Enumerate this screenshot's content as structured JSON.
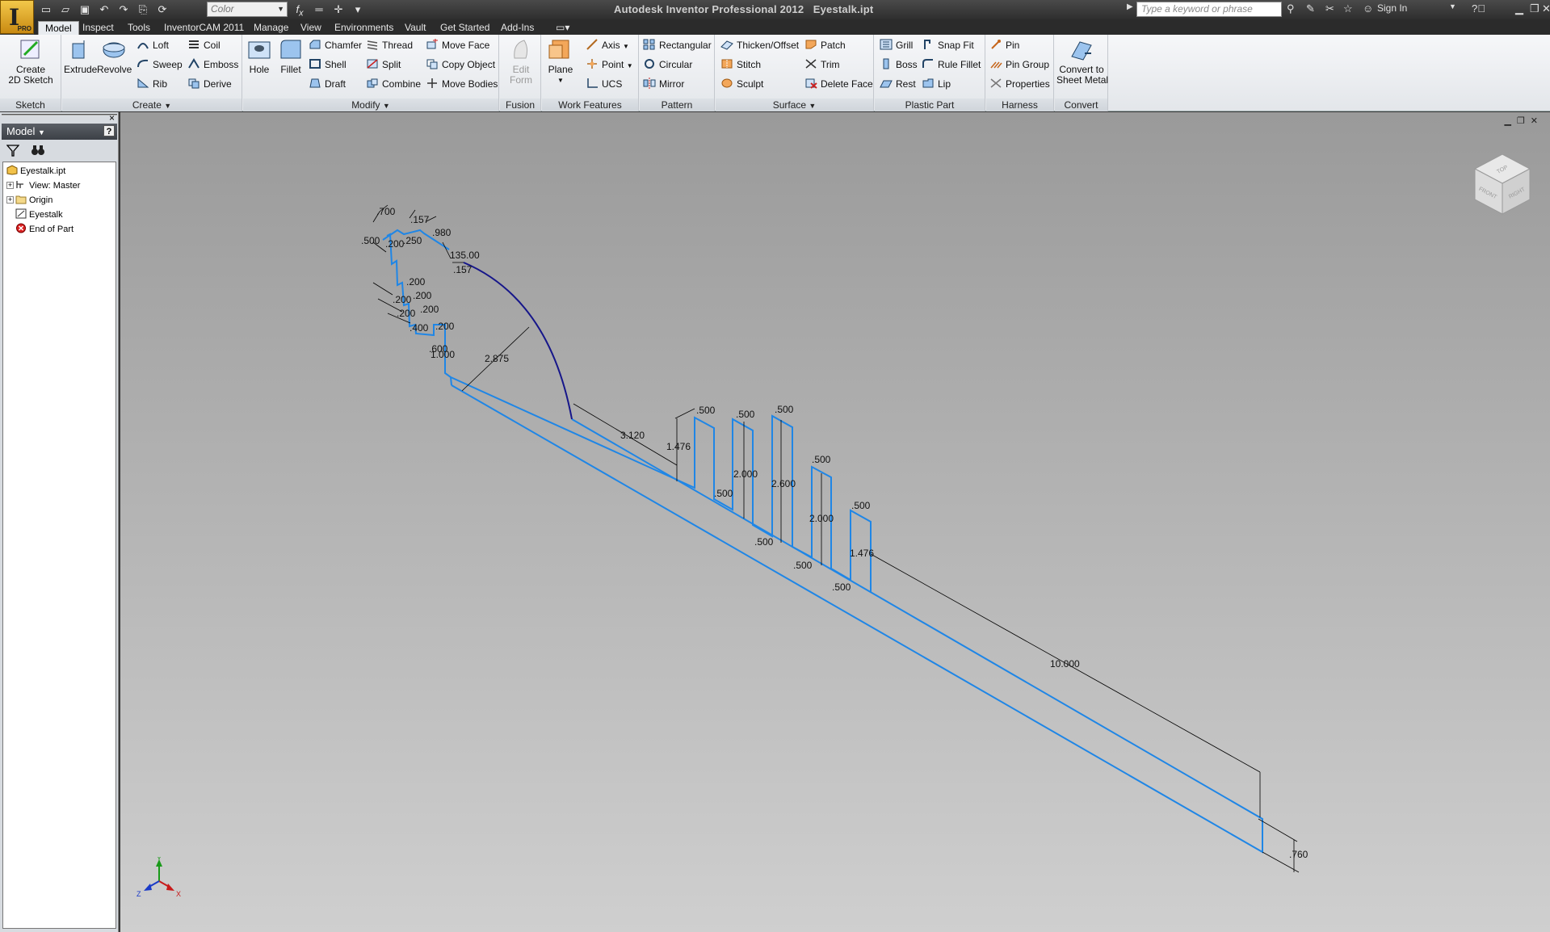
{
  "window": {
    "app_title": "Autodesk Inventor Professional 2012",
    "file_name": "Eyestalk.ipt",
    "logo_badge": "PRO"
  },
  "quick_access": {
    "color_combo": "Color",
    "search_placeholder": "Type a keyword or phrase",
    "sign_in": "Sign In"
  },
  "tabs": [
    "Model",
    "Inspect",
    "Tools",
    "InventorCAM 2011",
    "Manage",
    "View",
    "Environments",
    "Vault",
    "Get Started",
    "Add-Ins"
  ],
  "ribbon": {
    "sketch": {
      "label": "Sketch",
      "create_2d_sketch": "Create\n2D Sketch"
    },
    "create": {
      "label": "Create",
      "extrude": "Extrude",
      "revolve": "Revolve",
      "loft": "Loft",
      "sweep": "Sweep",
      "rib": "Rib",
      "coil": "Coil",
      "emboss": "Emboss",
      "derive": "Derive"
    },
    "modify": {
      "label": "Modify",
      "hole": "Hole",
      "fillet": "Fillet",
      "chamfer": "Chamfer",
      "shell": "Shell",
      "draft": "Draft",
      "thread": "Thread",
      "split": "Split",
      "combine": "Combine",
      "move_face": "Move Face",
      "copy_object": "Copy Object",
      "move_bodies": "Move Bodies"
    },
    "fusion": {
      "label": "Fusion",
      "edit_form": "Edit\nForm"
    },
    "work_features": {
      "label": "Work Features",
      "plane": "Plane",
      "axis": "Axis",
      "point": "Point",
      "ucs": "UCS"
    },
    "pattern": {
      "label": "Pattern",
      "rectangular": "Rectangular",
      "circular": "Circular",
      "mirror": "Mirror"
    },
    "surface": {
      "label": "Surface",
      "thicken_offset": "Thicken/Offset",
      "stitch": "Stitch",
      "sculpt": "Sculpt",
      "patch": "Patch",
      "trim": "Trim",
      "delete_face": "Delete Face"
    },
    "plastic_part": {
      "label": "Plastic Part",
      "grill": "Grill",
      "boss": "Boss",
      "rest": "Rest",
      "snap_fit": "Snap Fit",
      "rule_fillet": "Rule Fillet",
      "lip": "Lip"
    },
    "harness": {
      "label": "Harness",
      "pin": "Pin",
      "pin_group": "Pin Group",
      "properties": "Properties"
    },
    "convert": {
      "label": "Convert",
      "convert_to_sheet_metal": "Convert to\nSheet Metal"
    }
  },
  "browser": {
    "title": "Model",
    "help": "?",
    "close": "×",
    "nodes": [
      "Eyestalk.ipt",
      "View: Master",
      "Origin",
      "Eyestalk",
      "End of Part"
    ]
  },
  "viewcube": {
    "top": "TOP",
    "front": "FRONT",
    "right": "RIGHT"
  },
  "triad": {
    "x": "X",
    "y": "Y",
    "z": "Z"
  },
  "dimensions": {
    "d700": ".700",
    "d157a": ".157",
    "d980": ".980",
    "d500a": ".500",
    "d200a": ".200",
    "d250": ".250",
    "d135": "135.00",
    "d157b": ".157",
    "d200b": ".200",
    "d200c": ".200",
    "d200d": ".200",
    "d200e": ".200",
    "d200f": ".200",
    "d400": ".400",
    "d200g": ".200",
    "d600": ".600",
    "d1000": "1.000",
    "d2875": "2.875",
    "d3120": "3.120",
    "d1476a": "1.476",
    "d500b": ".500",
    "d500c": ".500",
    "d500d": ".500",
    "d500e": ".500",
    "d500f": ".500",
    "d2000a": "2.000",
    "d2600": "2.600",
    "d2000b": "2.000",
    "d500g": ".500",
    "d500h": ".500",
    "d500i": ".500",
    "d500j": ".500",
    "d1476b": "1.476",
    "d10000": "10.000",
    "d760": ".760"
  }
}
